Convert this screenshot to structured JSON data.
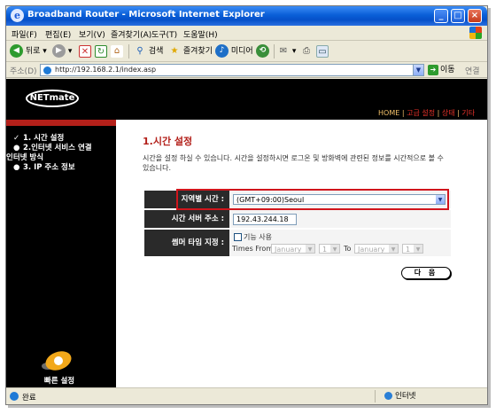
{
  "window": {
    "title": "Broadband Router - Microsoft Internet Explorer"
  },
  "menu": [
    "파일(F)",
    "편집(E)",
    "보기(V)",
    "즐겨찾기(A)",
    "도구(T)",
    "도움말(H)"
  ],
  "toolbar": {
    "back": "뒤로",
    "search": "검색",
    "favorites": "즐겨찾기",
    "media": "미디어"
  },
  "address": {
    "label": "주소(D)",
    "url": "http://192.168.2.1/index.asp",
    "go": "이동",
    "links": "연결"
  },
  "header": {
    "logo": "NETmate",
    "nav": [
      "HOME",
      "고급 설정",
      "상태",
      "기타"
    ]
  },
  "sidebar": {
    "items": [
      {
        "label": "1. 시간 설정",
        "marker": "✓"
      },
      {
        "label": "2.인터넷 서비스 연결",
        "marker": "●"
      },
      {
        "label": "인터넷 방식",
        "marker": ""
      },
      {
        "label": "3. IP 주소 정보",
        "marker": "●"
      }
    ],
    "quick_setup": "빠른 설정"
  },
  "main": {
    "title": "1.시간 설정",
    "description": "시간을 설정 하실 수 있습니다. 시간을 설정하시면 로그온 및 방화벽에 관련된 정보를 시간적으로 볼 수 있습니다.",
    "timezone_label": "지역별 시간 :",
    "timezone_value": "(GMT+09:00)Seoul",
    "ntp_label": "시간 서버 주소 :",
    "ntp_value": "192.43.244.18",
    "dst_label": "썸머 타임 지정 :",
    "dst_enable": "기능 사용",
    "times_from": "Times From",
    "to": "To",
    "from_month": "January",
    "from_day": "1",
    "to_month": "January",
    "to_day": "1",
    "next_button": "다 음"
  },
  "status": {
    "text": "완료",
    "zone": "인터넷"
  },
  "colors": {
    "accent": "#b3201a",
    "highlight": "#d1151c",
    "titlebar": "#0a5fd8"
  }
}
